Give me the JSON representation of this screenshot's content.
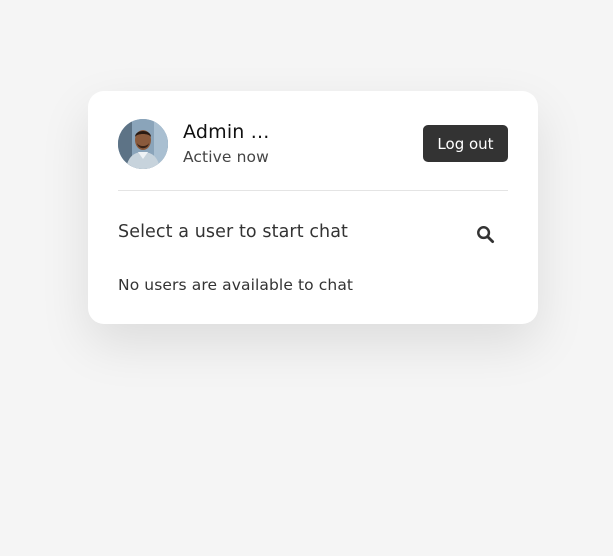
{
  "user": {
    "name": "Admin ...",
    "status": "Active now"
  },
  "header": {
    "logout_label": "Log out"
  },
  "search": {
    "text": "Select a user to start chat",
    "icon": "search-icon"
  },
  "users_list": {
    "empty_message": "No users are available to chat"
  },
  "colors": {
    "button_bg": "#333333",
    "card_bg": "#ffffff",
    "page_bg": "#f5f5f5"
  }
}
